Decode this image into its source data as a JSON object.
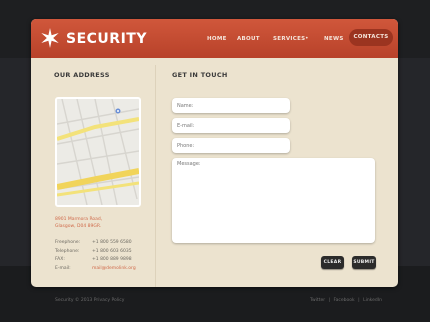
{
  "brand": {
    "name": "SECURITY",
    "color": "#c94d33"
  },
  "nav": {
    "items": [
      "HOME",
      "ABOUT",
      "SERVICES",
      "NEWS",
      "CONTACTS"
    ],
    "active": "CONTACTS"
  },
  "address_section": {
    "title": "OUR ADDRESS",
    "address_lines": [
      "8901 Marmora Road,",
      "Glasgow, D04 89GR."
    ],
    "contacts": [
      {
        "label": "Freephone:",
        "value": "+1 800 559 6580"
      },
      {
        "label": "Telephone:",
        "value": "+1 800 603 6035"
      },
      {
        "label": "FAX:",
        "value": "+1 800 889 9898"
      },
      {
        "label": "E-mail:",
        "value": "mail@demolink.org"
      }
    ]
  },
  "contact_form": {
    "title": "GET IN TOUCH",
    "name_placeholder": "Name:",
    "email_placeholder": "E-mail:",
    "phone_placeholder": "Phone:",
    "message_placeholder": "Message:",
    "clear_label": "CLEAR",
    "submit_label": "SUBMIT"
  },
  "footer": {
    "copyright": "Security © 2013 Privacy Policy",
    "social": [
      "Twitter",
      "Facebook",
      "LinkedIn"
    ],
    "separator": "|"
  }
}
